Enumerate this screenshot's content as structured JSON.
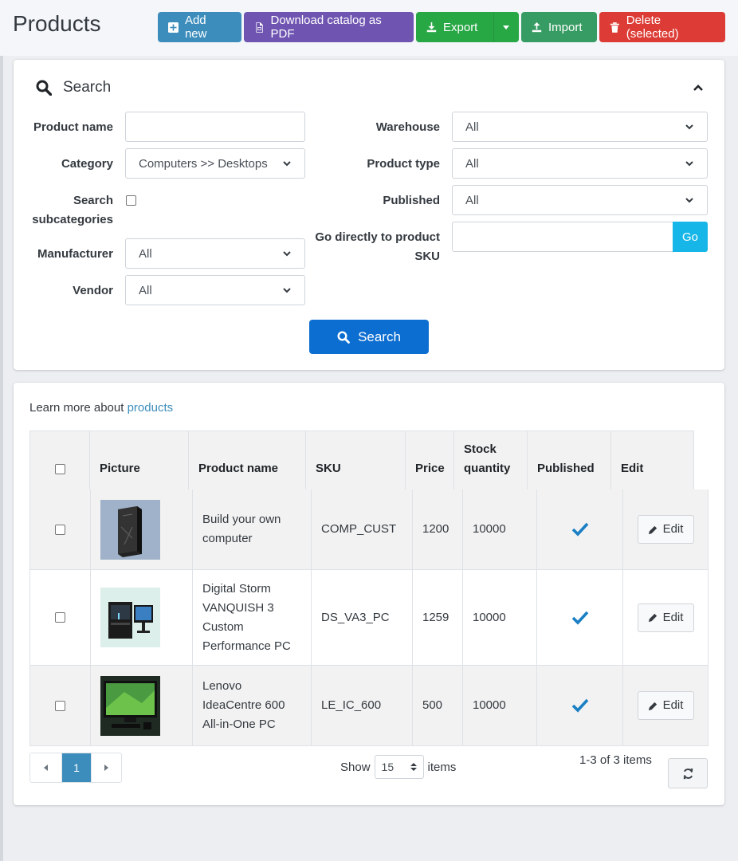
{
  "page": {
    "title": "Products"
  },
  "toolbar": {
    "add_new": "Add new",
    "download_pdf": "Download catalog as PDF",
    "export": "Export",
    "import": "Import",
    "delete_selected": "Delete (selected)"
  },
  "search": {
    "title": "Search",
    "product_name": {
      "label": "Product name",
      "value": ""
    },
    "category": {
      "label": "Category",
      "value": "Computers >> Desktops"
    },
    "search_subcategories": {
      "label": "Search subcategories",
      "checked": false
    },
    "manufacturer": {
      "label": "Manufacturer",
      "value": "All"
    },
    "vendor": {
      "label": "Vendor",
      "value": "All"
    },
    "warehouse": {
      "label": "Warehouse",
      "value": "All"
    },
    "product_type": {
      "label": "Product type",
      "value": "All"
    },
    "published": {
      "label": "Published",
      "value": "All"
    },
    "go_to_sku": {
      "label": "Go directly to product SKU",
      "value": "",
      "button": "Go"
    },
    "search_button": "Search"
  },
  "list": {
    "learn_more_prefix": "Learn more about",
    "learn_more_link": "products",
    "columns": {
      "picture": "Picture",
      "product_name": "Product name",
      "sku": "SKU",
      "price": "Price",
      "stock_quantity": "Stock quantity",
      "published": "Published",
      "edit": "Edit"
    },
    "rows": [
      {
        "name": "Build your own computer",
        "sku": "COMP_CUST",
        "price": "1200",
        "stock": "10000",
        "published": true,
        "edit": "Edit"
      },
      {
        "name": "Digital Storm VANQUISH 3 Custom Performance PC",
        "sku": "DS_VA3_PC",
        "price": "1259",
        "stock": "10000",
        "published": true,
        "edit": "Edit"
      },
      {
        "name": "Lenovo IdeaCentre 600 All-in-One PC",
        "sku": "LE_IC_600",
        "price": "500",
        "stock": "10000",
        "published": true,
        "edit": "Edit"
      }
    ],
    "pagination": {
      "current_page": "1"
    },
    "show_label": "Show",
    "page_size": "15",
    "items_label": "items",
    "items_count": "1-3 of 3 items"
  },
  "colors": {
    "add": "#3c8dbc",
    "pdf": "#6f55b1",
    "export": "#28a745",
    "import": "#379c63",
    "delete": "#dc3c35",
    "search_button": "#0d6ed1",
    "go_button": "#17b6e8",
    "check": "#1a7fc4"
  }
}
